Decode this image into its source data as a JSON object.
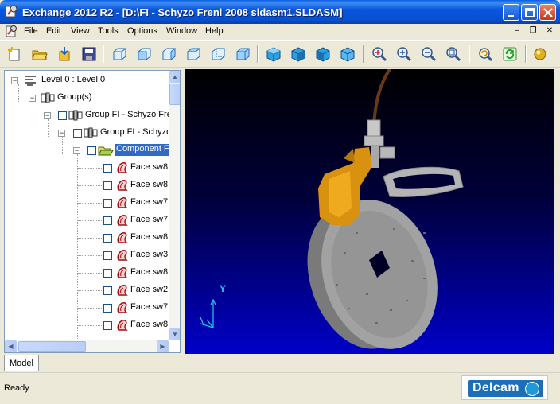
{
  "window": {
    "title": "Exchange 2012 R2 - [D:\\FI - Schyzo Freni 2008 sldasm1.SLDASM]"
  },
  "colors": {
    "titlebar": "#0a56db",
    "selection": "#316ac5",
    "viewport_top": "#000000",
    "viewport_bottom": "#0000c8",
    "model_gray": "#9a9a9a",
    "model_orange": "#e09a10"
  },
  "menu": {
    "items": [
      "File",
      "Edit",
      "View",
      "Tools",
      "Options",
      "Window",
      "Help"
    ]
  },
  "toolbar": {
    "icons": [
      "new-icon",
      "open-icon",
      "import-icon",
      "save-icon",
      "view-iso-icon",
      "view-front-icon",
      "view-back-icon",
      "view-left-icon",
      "view-right-icon",
      "view-top-icon",
      "shaded-cube-icon",
      "shaded-cube-2-icon",
      "shaded-cube-3-icon",
      "shaded-cube-4-icon",
      "zoom-fit-icon",
      "zoom-in-icon",
      "zoom-out-icon",
      "zoom-box-icon",
      "rotate-icon",
      "refresh-icon",
      "sphere-icon"
    ]
  },
  "tree": {
    "root": "Level 0 : Level 0",
    "groups": "Group(s)",
    "group1": "Group FI - Schyzo Fre",
    "group2": "Group FI - Schyzo",
    "component": "Component F",
    "faces": [
      "Face sw8",
      "Face sw8",
      "Face sw7",
      "Face sw7",
      "Face sw8",
      "Face sw3",
      "Face sw8",
      "Face sw2",
      "Face sw7",
      "Face sw8"
    ]
  },
  "viewport": {
    "axis_label_y": "Y"
  },
  "tabs": {
    "model": "Model"
  },
  "status": {
    "text": "Ready"
  },
  "brand": {
    "name": "Delcam"
  }
}
